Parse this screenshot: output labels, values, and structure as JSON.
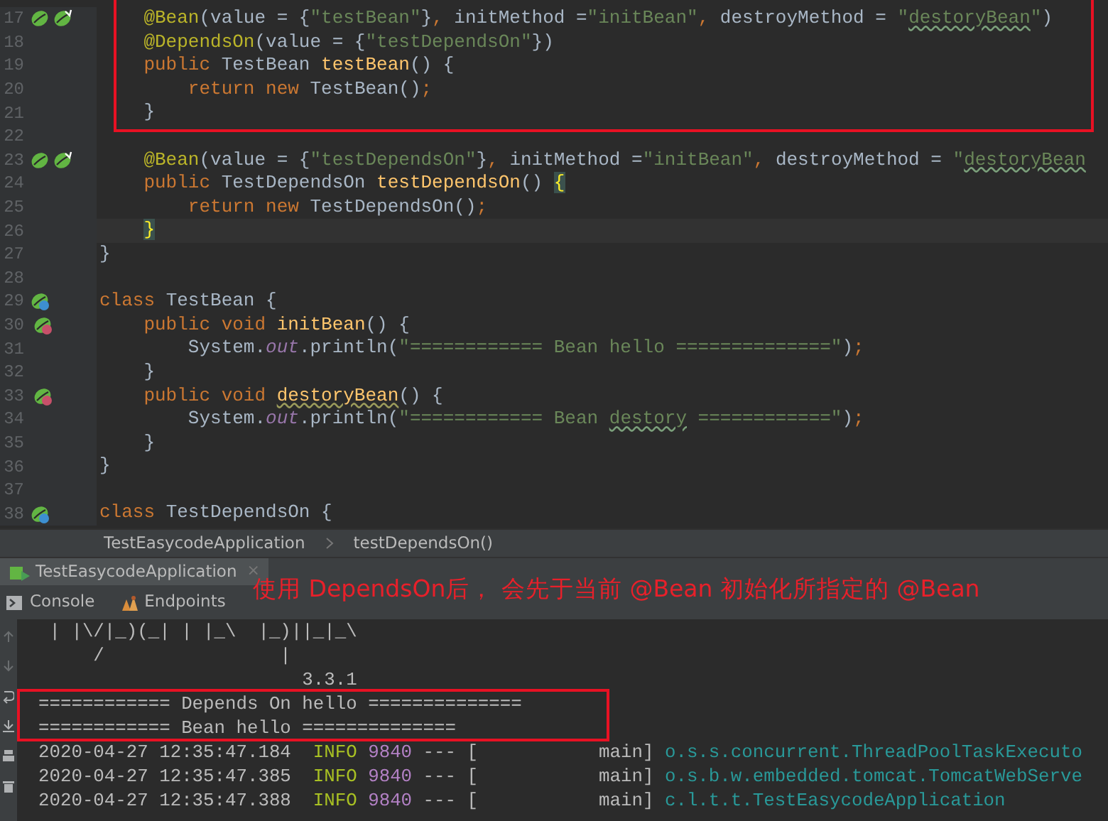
{
  "editor": {
    "lines": [
      {
        "number": "17",
        "kind": "bean-pair",
        "tokens": [
          {
            "kind": "annotation",
            "text": "    @Bean"
          },
          {
            "kind": "plain",
            "text": "(value = {"
          },
          {
            "kind": "string",
            "text": "\"testBean\""
          },
          {
            "kind": "plain",
            "text": "}"
          },
          {
            "kind": "punct",
            "text": ", "
          },
          {
            "kind": "plain",
            "text": "initMethod ="
          },
          {
            "kind": "string",
            "text": "\"initBean\""
          },
          {
            "kind": "punct",
            "text": ", "
          },
          {
            "kind": "plain",
            "text": "destroyMethod = "
          },
          {
            "kind": "string",
            "text": "\""
          },
          {
            "kind": "string-typo",
            "text": "destoryBean"
          },
          {
            "kind": "string",
            "text": "\""
          },
          {
            "kind": "plain",
            "text": ")"
          }
        ]
      },
      {
        "number": "18",
        "tokens": [
          {
            "kind": "annotation",
            "text": "    @DependsOn"
          },
          {
            "kind": "plain",
            "text": "(value = {"
          },
          {
            "kind": "string",
            "text": "\"testDependsOn\""
          },
          {
            "kind": "plain",
            "text": "})"
          }
        ]
      },
      {
        "number": "19",
        "tokens": [
          {
            "kind": "keyword",
            "text": "    public"
          },
          {
            "kind": "plain",
            "text": " TestBean "
          },
          {
            "kind": "method",
            "text": "testBean"
          },
          {
            "kind": "plain",
            "text": "() {"
          }
        ]
      },
      {
        "number": "20",
        "tokens": [
          {
            "kind": "keyword",
            "text": "        return new"
          },
          {
            "kind": "plain",
            "text": " TestBean()"
          },
          {
            "kind": "punct",
            "text": ";"
          }
        ]
      },
      {
        "number": "21",
        "tokens": [
          {
            "kind": "plain",
            "text": "    }"
          }
        ]
      },
      {
        "number": "22"
      },
      {
        "number": "23",
        "kind": "bean-pair",
        "tokens": [
          {
            "kind": "annotation",
            "text": "    @Bean"
          },
          {
            "kind": "plain",
            "text": "(value = {"
          },
          {
            "kind": "string",
            "text": "\"testDependsOn\""
          },
          {
            "kind": "plain",
            "text": "}"
          },
          {
            "kind": "punct",
            "text": ", "
          },
          {
            "kind": "plain",
            "text": "initMethod ="
          },
          {
            "kind": "string",
            "text": "\"initBean\""
          },
          {
            "kind": "punct",
            "text": ", "
          },
          {
            "kind": "plain",
            "text": "destroyMethod = "
          },
          {
            "kind": "string",
            "text": "\""
          },
          {
            "kind": "string-typo",
            "text": "destoryBean"
          }
        ]
      },
      {
        "number": "24",
        "tokens": [
          {
            "kind": "keyword",
            "text": "    public"
          },
          {
            "kind": "plain",
            "text": " TestDependsOn "
          },
          {
            "kind": "method",
            "text": "testDependsOn"
          },
          {
            "kind": "plain",
            "text": "() "
          },
          {
            "kind": "brace-match",
            "text": "{"
          }
        ]
      },
      {
        "number": "25",
        "tokens": [
          {
            "kind": "keyword",
            "text": "        return new"
          },
          {
            "kind": "plain",
            "text": " TestDependsOn()"
          },
          {
            "kind": "punct",
            "text": ";"
          }
        ]
      },
      {
        "number": "26",
        "current": true,
        "tokens": [
          {
            "kind": "brace-match",
            "text": "    }"
          }
        ]
      },
      {
        "number": "27",
        "tokens": [
          {
            "kind": "plain",
            "text": "}"
          }
        ]
      },
      {
        "number": "28"
      },
      {
        "number": "29",
        "kind": "bean-class",
        "tokens": [
          {
            "kind": "keyword",
            "text": "class"
          },
          {
            "kind": "plain",
            "text": " TestBean {"
          }
        ]
      },
      {
        "number": "30",
        "kind": "bean-method",
        "tokens": [
          {
            "kind": "keyword",
            "text": "    public void"
          },
          {
            "kind": "method",
            "text": " initBean"
          },
          {
            "kind": "plain",
            "text": "() {"
          }
        ]
      },
      {
        "number": "31",
        "tokens": [
          {
            "kind": "plain",
            "text": "        System."
          },
          {
            "kind": "field",
            "text": "out"
          },
          {
            "kind": "plain",
            "text": ".println("
          },
          {
            "kind": "string",
            "text": "\"============ Bean hello ==============\""
          },
          {
            "kind": "plain",
            "text": ")"
          },
          {
            "kind": "punct",
            "text": ";"
          }
        ]
      },
      {
        "number": "32",
        "tokens": [
          {
            "kind": "plain",
            "text": "    }"
          }
        ]
      },
      {
        "number": "33",
        "kind": "bean-method",
        "tokens": [
          {
            "kind": "keyword",
            "text": "    public void "
          },
          {
            "kind": "method-typo",
            "text": "destoryBean"
          },
          {
            "kind": "plain",
            "text": "() {"
          }
        ]
      },
      {
        "number": "34",
        "tokens": [
          {
            "kind": "plain",
            "text": "        System."
          },
          {
            "kind": "field",
            "text": "out"
          },
          {
            "kind": "plain",
            "text": ".println("
          },
          {
            "kind": "string",
            "text": "\"============ Bean "
          },
          {
            "kind": "string-typo",
            "text": "destory"
          },
          {
            "kind": "string",
            "text": " ============\""
          },
          {
            "kind": "plain",
            "text": ")"
          },
          {
            "kind": "punct",
            "text": ";"
          }
        ]
      },
      {
        "number": "35",
        "tokens": [
          {
            "kind": "plain",
            "text": "    }"
          }
        ]
      },
      {
        "number": "36",
        "tokens": [
          {
            "kind": "plain",
            "text": "}"
          }
        ]
      },
      {
        "number": "37"
      },
      {
        "number": "38",
        "kind": "bean-class",
        "tokens": [
          {
            "kind": "keyword",
            "text": "class"
          },
          {
            "kind": "plain",
            "text": " TestDependsOn {"
          }
        ]
      }
    ]
  },
  "breadcrumbs": [
    "TestEasycodeApplication",
    "testDependsOn()"
  ],
  "run_panel": {
    "run_tab": "TestEasycodeApplication",
    "close": "×",
    "note": "使用 DependsOn后，  会先于当前 @Bean 初始化所指定的 @Bean",
    "tabs": [
      {
        "label": "Console"
      },
      {
        "label": "Endpoints"
      }
    ],
    "console_lines": [
      {
        "tokens": [
          {
            "kind": "plain",
            "text": " | |\\/|_)(_| | |_\\  |_)||_|_\\"
          }
        ]
      },
      {
        "tokens": [
          {
            "kind": "plain",
            "text": "     /                |"
          }
        ]
      },
      {
        "tokens": [
          {
            "kind": "plain",
            "text": "                        3.3.1"
          }
        ]
      },
      {
        "tokens": [
          {
            "kind": "plain",
            "text": "============ Depends On hello =============="
          }
        ]
      },
      {
        "tokens": [
          {
            "kind": "plain",
            "text": "============ Bean hello =============="
          }
        ]
      },
      {
        "tokens": [
          {
            "kind": "plain",
            "text": "2020-04-27 12:35:47.184  "
          },
          {
            "kind": "level",
            "text": "INFO"
          },
          {
            "kind": "pid",
            "text": " 9840"
          },
          {
            "kind": "plain",
            "text": " --- [           main] "
          },
          {
            "kind": "logger",
            "text": "o.s.s.concurrent.ThreadPoolTaskExecuto"
          }
        ]
      },
      {
        "tokens": [
          {
            "kind": "plain",
            "text": "2020-04-27 12:35:47.385  "
          },
          {
            "kind": "level",
            "text": "INFO"
          },
          {
            "kind": "pid",
            "text": " 9840"
          },
          {
            "kind": "plain",
            "text": " --- [           main] "
          },
          {
            "kind": "logger",
            "text": "o.s.b.w.embedded.tomcat.TomcatWebServe"
          }
        ]
      },
      {
        "tokens": [
          {
            "kind": "plain",
            "text": "2020-04-27 12:35:47.388  "
          },
          {
            "kind": "level",
            "text": "INFO"
          },
          {
            "kind": "pid",
            "text": " 9840"
          },
          {
            "kind": "plain",
            "text": " --- [           main] "
          },
          {
            "kind": "logger",
            "text": "c.l.t.t.TestEasycodeApplication"
          }
        ]
      }
    ]
  }
}
